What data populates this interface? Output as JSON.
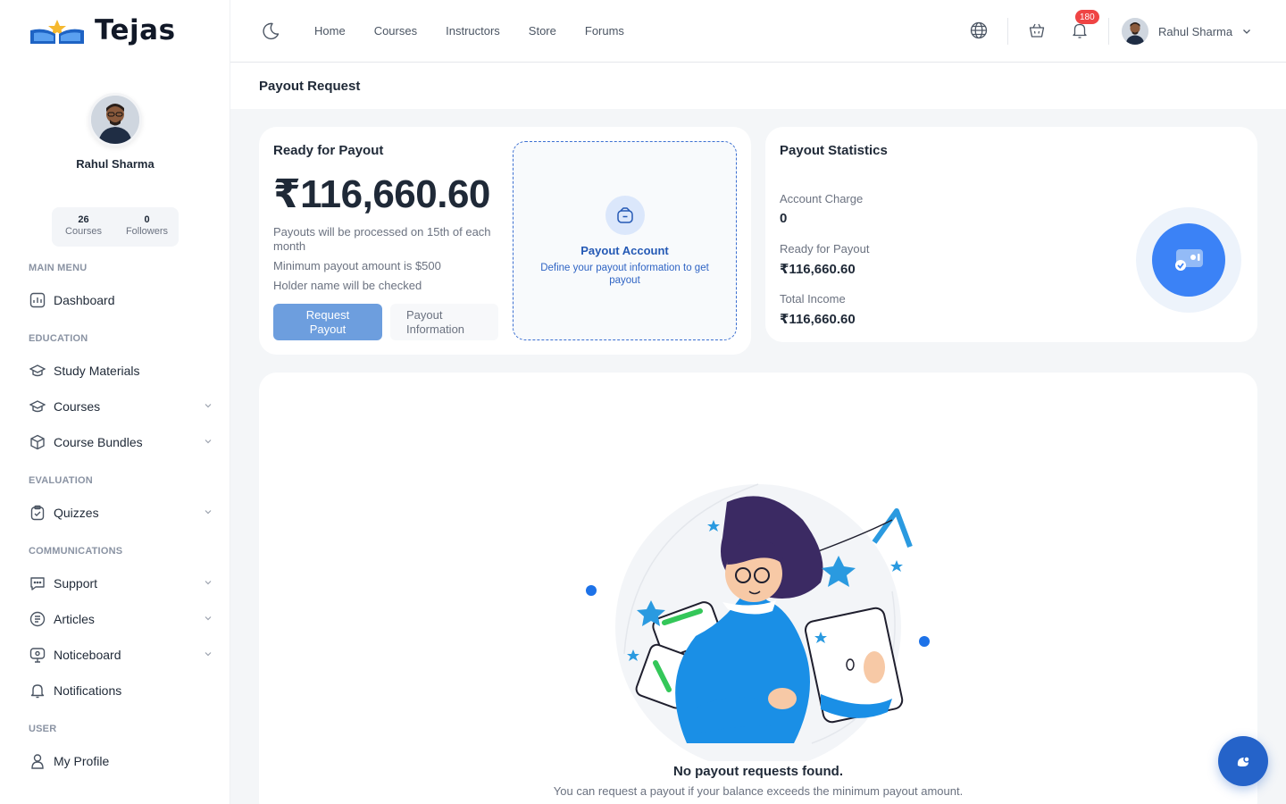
{
  "brand": {
    "name": "Tejas"
  },
  "sidebar": {
    "profile": {
      "name": "Rahul Sharma"
    },
    "stats": [
      {
        "value": "26",
        "label": "Courses"
      },
      {
        "value": "0",
        "label": "Followers"
      }
    ],
    "sections": {
      "main": "MAIN MENU",
      "education": "EDUCATION",
      "evaluation": "EVALUATION",
      "communications": "COMMUNICATIONS",
      "user": "USER"
    },
    "items": {
      "dashboard": "Dashboard",
      "study_materials": "Study Materials",
      "courses": "Courses",
      "course_bundles": "Course Bundles",
      "quizzes": "Quizzes",
      "support": "Support",
      "articles": "Articles",
      "noticeboard": "Noticeboard",
      "notifications": "Notifications",
      "my_profile": "My Profile"
    }
  },
  "topnav": {
    "links": [
      "Home",
      "Courses",
      "Instructors",
      "Store",
      "Forums"
    ],
    "notification_count": "180",
    "user_name": "Rahul Sharma"
  },
  "page": {
    "title": "Payout Request"
  },
  "ready_card": {
    "title": "Ready for Payout",
    "amount": "₹116,660.60",
    "info": [
      "Payouts will be processed on 15th of each month",
      "Minimum payout amount is $500",
      "Holder name will be checked"
    ],
    "request_button": "Request Payout",
    "info_button": "Payout Information",
    "account": {
      "title": "Payout Account",
      "description": "Define your payout information to get payout"
    }
  },
  "stats_card": {
    "title": "Payout Statistics",
    "rows": [
      {
        "label": "Account Charge",
        "value": "0"
      },
      {
        "label": "Ready for Payout",
        "value": "₹116,660.60"
      },
      {
        "label": "Total Income",
        "value": "₹116,660.60"
      }
    ]
  },
  "empty_state": {
    "title": "No payout requests found.",
    "description": "You can request a payout if your balance exceeds the minimum payout amount."
  },
  "colors": {
    "primary": "#2563c9",
    "primary_light": "#6d9ede",
    "badge": "#ef4444",
    "accent_blue": "#3b82f6"
  }
}
